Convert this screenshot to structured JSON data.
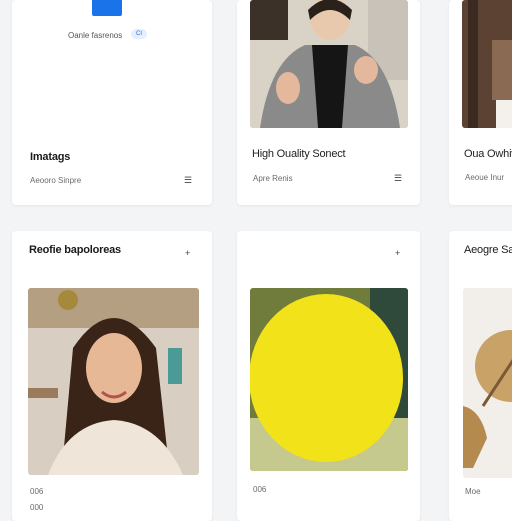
{
  "top_row": {
    "card1": {
      "header_label": "Oanle fasrenos",
      "badge": "CI",
      "title": "Imatags",
      "meta": "Aeooro Sinpre",
      "icon": "bookmark-icon"
    },
    "card2": {
      "title": "High Ouality Sonect",
      "meta": "Apre Renis",
      "icon": "bookmark-icon"
    },
    "card3": {
      "title": "Oua Owhiv",
      "meta": "Aeoue Inur"
    }
  },
  "bottom_row": {
    "card4": {
      "title": "Reofie bapoloreas",
      "action_icon": "plus-icon",
      "caption_1": "006",
      "caption_2": "000"
    },
    "card5": {
      "action_icon": "plus-icon",
      "caption": "006"
    },
    "card6": {
      "title": "Aeogre Sa",
      "caption": "Moe"
    }
  },
  "colors": {
    "accent_blue": "#1a73e8",
    "yellow": "#f2e21a"
  }
}
